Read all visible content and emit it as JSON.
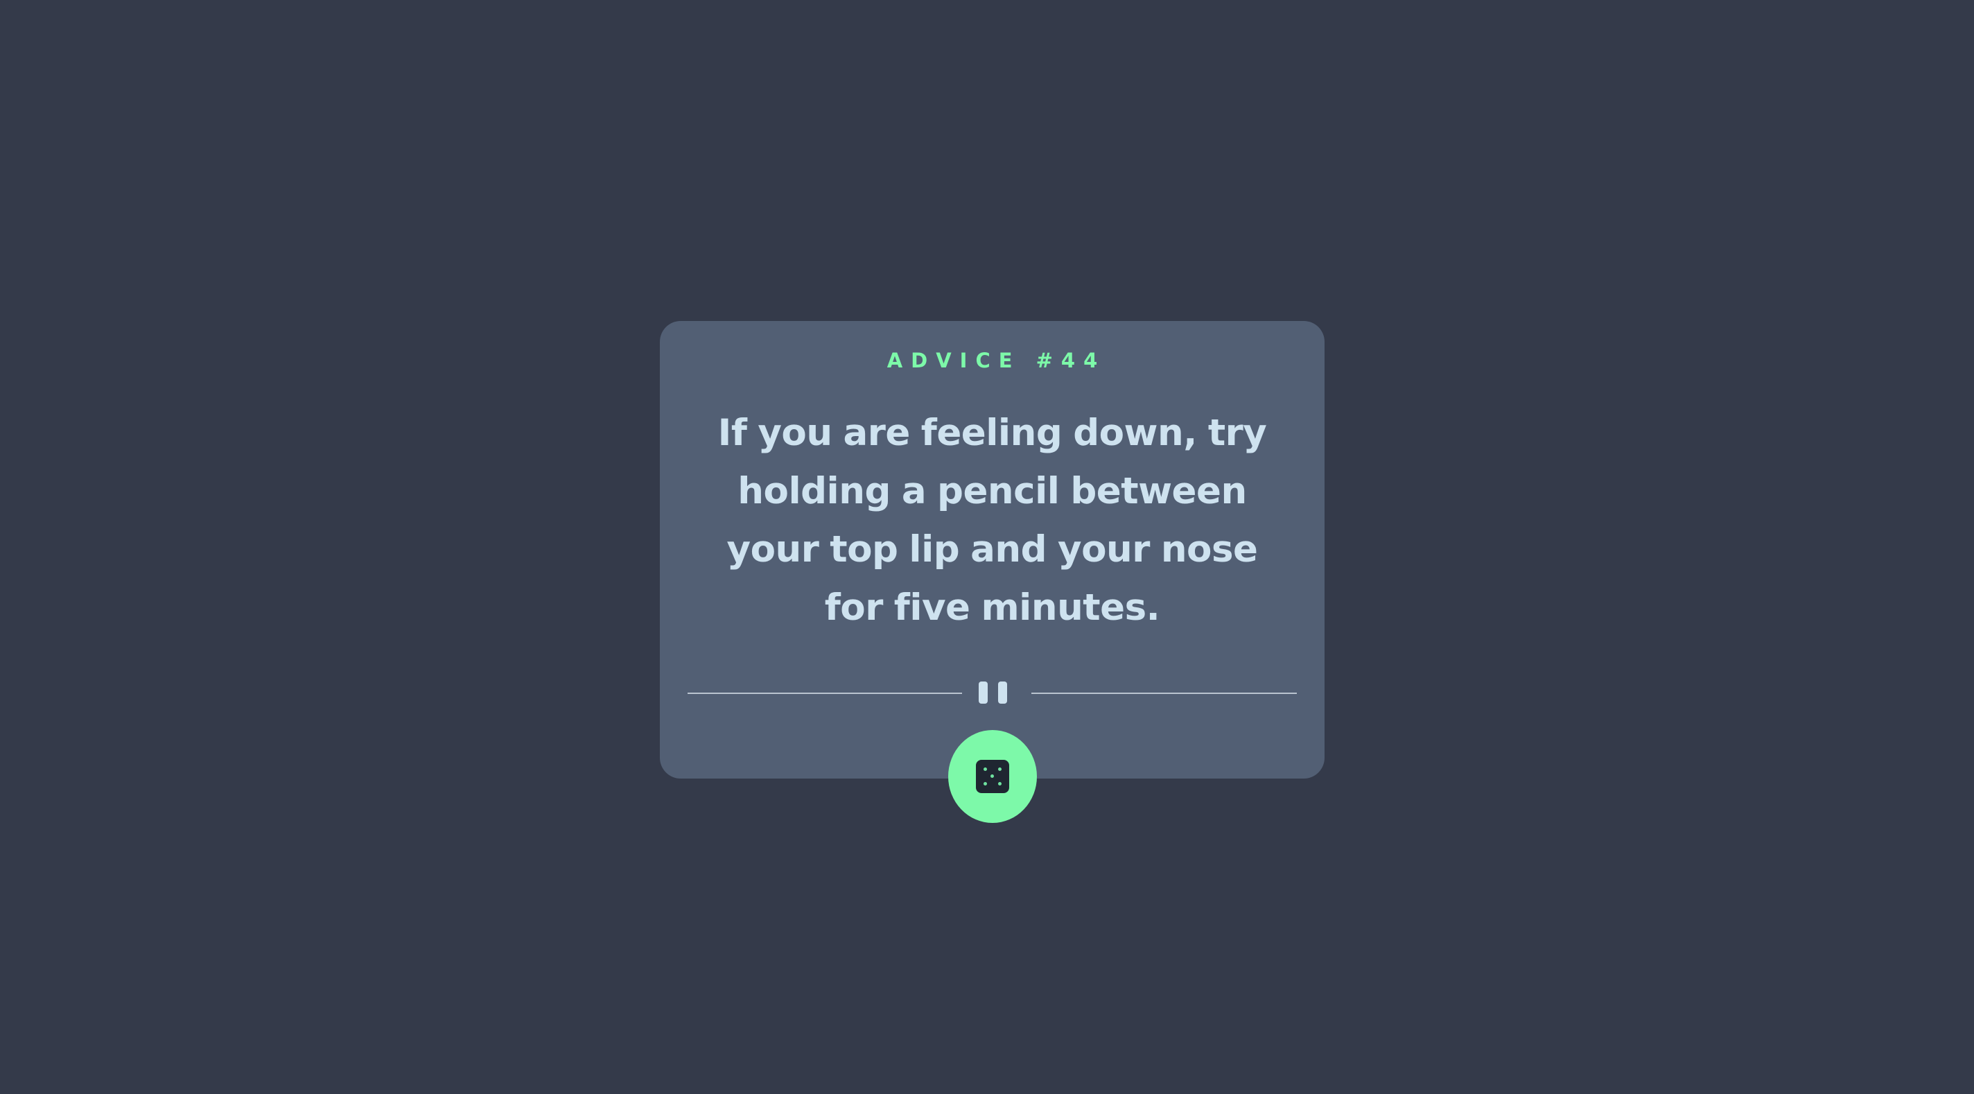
{
  "colors": {
    "background": "#343a4a",
    "card": "#525f74",
    "accent": "#7df9a9",
    "text": "#cee2ef",
    "dice_face": "#1f2631"
  },
  "card": {
    "label": "ADVICE #44",
    "quote": "If you are feeling down, try holding a pencil between your top lip and your nose for five minutes.",
    "divider_icon": "pause-icon"
  },
  "action": {
    "icon": "dice-icon"
  }
}
